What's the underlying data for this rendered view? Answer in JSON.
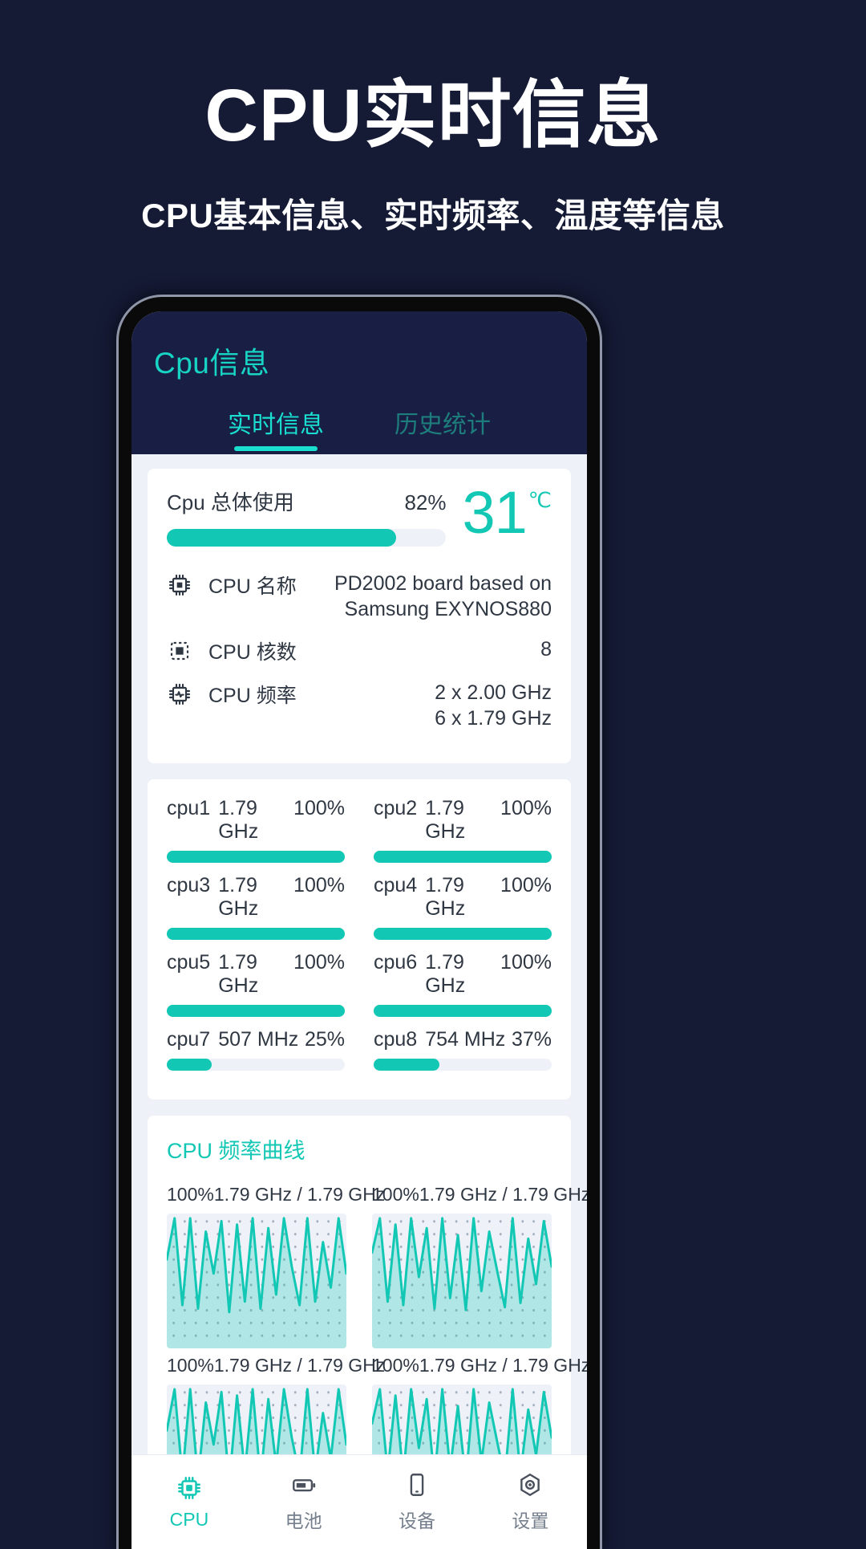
{
  "promo": {
    "title": "CPU实时信息",
    "subtitle": "CPU基本信息、实时频率、温度等信息"
  },
  "app": {
    "title": "Cpu信息",
    "tabs": [
      {
        "label": "实时信息",
        "active": true
      },
      {
        "label": "历史统计",
        "active": false
      }
    ]
  },
  "usage": {
    "label": "Cpu 总体使用",
    "percent_text": "82%",
    "percent": 82,
    "temperature": "31",
    "temperature_unit": "℃"
  },
  "info": [
    {
      "icon": "cpu-chip-icon",
      "name": "CPU 名称",
      "value": "PD2002 board based on Samsung EXYNOS880"
    },
    {
      "icon": "cpu-cores-icon",
      "name": "CPU 核数",
      "value": "8"
    },
    {
      "icon": "cpu-freq-icon",
      "name": "CPU 频率",
      "value": "2 x 2.00 GHz\n6 x 1.79 GHz"
    }
  ],
  "cores": [
    {
      "id": "cpu1",
      "freq": "1.79 GHz",
      "pct_text": "100%",
      "pct": 100
    },
    {
      "id": "cpu2",
      "freq": "1.79 GHz",
      "pct_text": "100%",
      "pct": 100
    },
    {
      "id": "cpu3",
      "freq": "1.79 GHz",
      "pct_text": "100%",
      "pct": 100
    },
    {
      "id": "cpu4",
      "freq": "1.79 GHz",
      "pct_text": "100%",
      "pct": 100
    },
    {
      "id": "cpu5",
      "freq": "1.79 GHz",
      "pct_text": "100%",
      "pct": 100
    },
    {
      "id": "cpu6",
      "freq": "1.79 GHz",
      "pct_text": "100%",
      "pct": 100
    },
    {
      "id": "cpu7",
      "freq": "507 MHz",
      "pct_text": "25%",
      "pct": 25
    },
    {
      "id": "cpu8",
      "freq": "754 MHz",
      "pct_text": "37%",
      "pct": 37
    }
  ],
  "charts": {
    "title": "CPU 频率曲线",
    "cells": [
      {
        "label": "100%1.79 GHz / 1.79 GHz"
      },
      {
        "label": "100%1.79 GHz / 1.79 GHz"
      },
      {
        "label": "100%1.79 GHz / 1.79 GHz"
      },
      {
        "label": "100%1.79 GHz / 1.79 GHz"
      }
    ]
  },
  "bottom_nav": [
    {
      "label": "CPU",
      "icon": "cpu-icon",
      "active": true
    },
    {
      "label": "电池",
      "icon": "battery-icon",
      "active": false
    },
    {
      "label": "设备",
      "icon": "device-icon",
      "active": false
    },
    {
      "label": "设置",
      "icon": "settings-icon",
      "active": false
    }
  ],
  "colors": {
    "background": "#151a35",
    "accent": "#12c8b4",
    "appbar": "#191f44",
    "tab_active": "#19ded0",
    "tab_inactive": "#1d7d7c"
  },
  "chart_data": {
    "type": "line",
    "title": "CPU 频率曲线",
    "xlabel": "",
    "ylabel": "GHz",
    "ylim": [
      0,
      1.79
    ],
    "grid": true,
    "legend": "none",
    "series": [
      {
        "name": "cpu1",
        "values": [
          1.2,
          1.79,
          0.55,
          1.79,
          0.5,
          1.6,
          1.0,
          1.75,
          0.45,
          1.7,
          0.6,
          1.79,
          0.5,
          1.65,
          0.7,
          1.79,
          1.1,
          0.55,
          1.79,
          0.6,
          1.45,
          0.8,
          1.79,
          1.0
        ]
      },
      {
        "name": "cpu2",
        "values": [
          1.3,
          1.79,
          0.6,
          1.7,
          0.55,
          1.79,
          0.95,
          1.65,
          0.5,
          1.79,
          0.65,
          1.55,
          0.48,
          1.79,
          0.75,
          1.6,
          1.05,
          0.52,
          1.79,
          0.58,
          1.5,
          0.85,
          1.75,
          1.1
        ]
      },
      {
        "name": "cpu3",
        "values": [
          1.2,
          1.79,
          0.55,
          1.79,
          0.5,
          1.6,
          1.0,
          1.75,
          0.45,
          1.7,
          0.6,
          1.79,
          0.5,
          1.65,
          0.7,
          1.79,
          1.1,
          0.55,
          1.79,
          0.6,
          1.45,
          0.8,
          1.79,
          1.0
        ]
      },
      {
        "name": "cpu4",
        "values": [
          1.3,
          1.79,
          0.6,
          1.7,
          0.55,
          1.79,
          0.95,
          1.65,
          0.5,
          1.79,
          0.65,
          1.55,
          0.48,
          1.79,
          0.75,
          1.6,
          1.05,
          0.52,
          1.79,
          0.58,
          1.5,
          0.85,
          1.75,
          1.1
        ]
      }
    ]
  }
}
